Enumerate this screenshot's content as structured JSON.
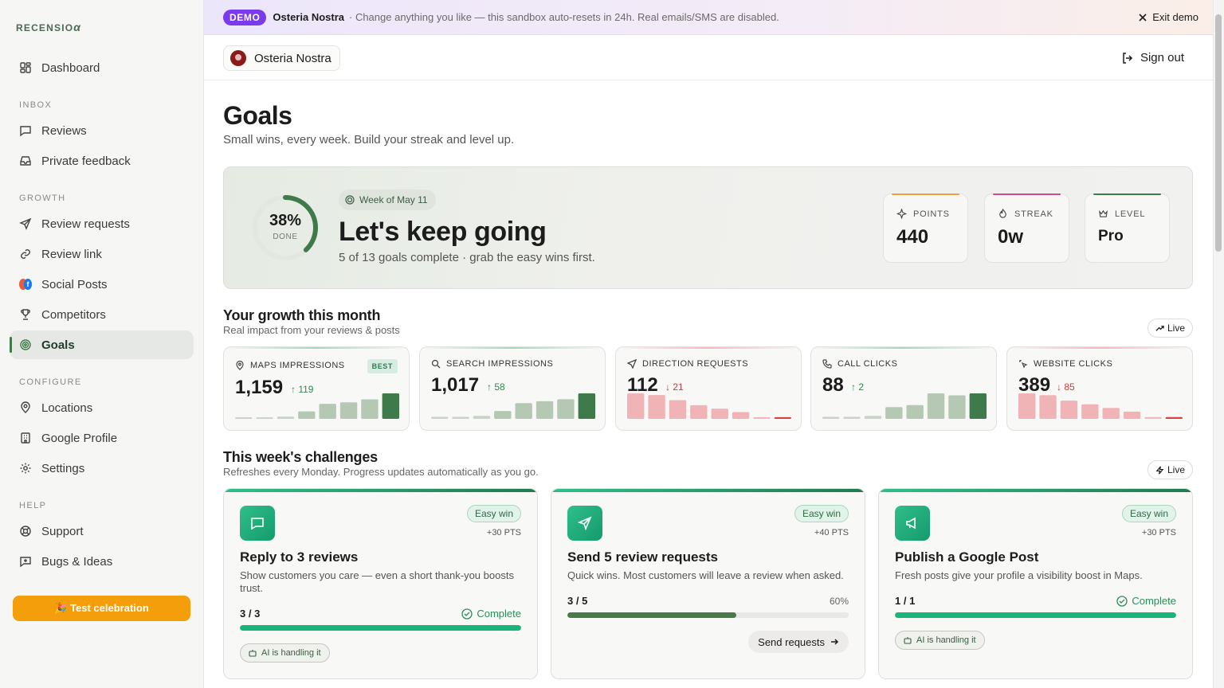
{
  "brand": {
    "name": "RECENSIO",
    "mark": "α"
  },
  "sidebar": {
    "sections": {
      "inbox": "INBOX",
      "growth": "GROWTH",
      "configure": "CONFIGURE",
      "help": "HELP"
    },
    "items": {
      "dashboard": "Dashboard",
      "reviews": "Reviews",
      "private_feedback": "Private feedback",
      "review_requests": "Review requests",
      "review_link": "Review link",
      "social_posts": "Social Posts",
      "competitors": "Competitors",
      "goals": "Goals",
      "locations": "Locations",
      "google_profile": "Google Profile",
      "settings": "Settings",
      "support": "Support",
      "bugs_ideas": "Bugs & Ideas"
    },
    "active": "Goals",
    "test_button": "🎉 Test celebration"
  },
  "demo_bar": {
    "badge": "DEMO",
    "name": "Osteria Nostra",
    "message": "· Change anything you like — this sandbox auto-resets in 24h. Real emails/SMS are disabled.",
    "exit": "Exit demo"
  },
  "topbar": {
    "location": "Osteria Nostra",
    "sign_out": "Sign out"
  },
  "page": {
    "title": "Goals",
    "subtitle": "Small wins, every week. Build your streak and level up."
  },
  "hero": {
    "percent": "38%",
    "percent_value": 0.38,
    "done_label": "DONE",
    "week": "Week of May 11",
    "headline": "Let's keep going",
    "summary": "5 of 13 goals complete · grab the easy wins first.",
    "stats": {
      "points": {
        "label": "POINTS",
        "value": "440",
        "color": "#f0a040"
      },
      "streak": {
        "label": "STREAK",
        "value": "0w",
        "color": "#d04a8a"
      },
      "level": {
        "label": "LEVEL",
        "value": "Pro",
        "color": "#3f7a4a"
      }
    }
  },
  "growth": {
    "title": "Your growth this month",
    "subtitle": "Real impact from your reviews & posts",
    "live": "Live",
    "metrics": [
      {
        "label": "MAPS IMPRESSIONS",
        "value": "1,159",
        "delta": "119",
        "dir": "up",
        "best": "BEST",
        "bars": [
          2,
          2,
          3,
          10,
          20,
          22,
          26,
          34
        ]
      },
      {
        "label": "SEARCH IMPRESSIONS",
        "value": "1,017",
        "delta": "58",
        "dir": "up",
        "bars": [
          2,
          2,
          3,
          8,
          16,
          18,
          20,
          26
        ]
      },
      {
        "label": "DIRECTION REQUESTS",
        "value": "112",
        "delta": "21",
        "dir": "down",
        "bars": [
          30,
          28,
          22,
          16,
          12,
          8,
          2,
          2
        ]
      },
      {
        "label": "CALL CLICKS",
        "value": "88",
        "delta": "2",
        "dir": "up",
        "bars": [
          2,
          2,
          3,
          12,
          14,
          26,
          24,
          26
        ]
      },
      {
        "label": "WEBSITE CLICKS",
        "value": "389",
        "delta": "85",
        "dir": "down",
        "bars": [
          28,
          26,
          20,
          16,
          12,
          8,
          2,
          2
        ]
      }
    ]
  },
  "challenges": {
    "title": "This week's challenges",
    "subtitle": "Refreshes every Monday. Progress updates automatically as you go.",
    "live": "Live",
    "items": [
      {
        "title": "Reply to 3 reviews",
        "desc": "Show customers you care — even a short thank-you boosts trust.",
        "badge": "Easy win",
        "pts": "+30 PTS",
        "progress": "3 / 3",
        "fraction": 1.0,
        "status": "Complete",
        "ai": "AI is handling it"
      },
      {
        "title": "Send 5 review requests",
        "desc": "Quick wins. Most customers will leave a review when asked.",
        "badge": "Easy win",
        "pts": "+40 PTS",
        "progress": "3 / 5",
        "fraction": 0.6,
        "pct": "60%",
        "action": "Send requests"
      },
      {
        "title": "Publish a Google Post",
        "desc": "Fresh posts give your profile a visibility boost in Maps.",
        "badge": "Easy win",
        "pts": "+30 PTS",
        "progress": "1 / 1",
        "fraction": 1.0,
        "status": "Complete",
        "ai": "AI is handling it"
      }
    ]
  },
  "colors": {
    "accent": "#3f7a4a",
    "complete": "#1ab37a",
    "partial": "#4a7a4a",
    "up": "#2f8a4f",
    "down": "#d03a3a"
  }
}
